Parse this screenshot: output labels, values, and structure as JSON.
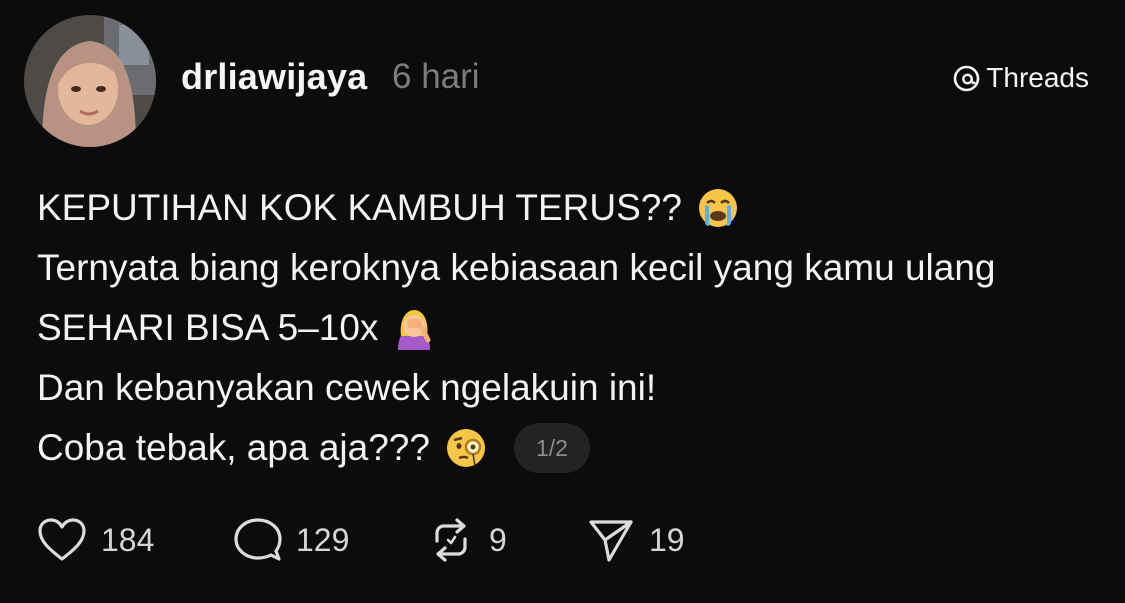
{
  "post": {
    "username": "drliawijaya",
    "timestamp": "6 hari",
    "brand": "Threads",
    "avatar_icon": "profile-photo",
    "lines": [
      "KEPUTIHAN KOK KAMBUH TERUS??",
      "Ternyata biang keroknya kebiasaan kecil yang kamu ulang",
      "SEHARI BISA 5–10x",
      "Dan kebanyakan cewek ngelakuin ini!",
      "Coba tebak, apa aja???"
    ],
    "emojis": {
      "line1": "crying-face-icon",
      "line3": "face-palm-icon",
      "line5": "monocle-face-icon"
    },
    "page_indicator": "1/2"
  },
  "actions": {
    "likes": "184",
    "replies": "129",
    "reposts": "9",
    "shares": "19",
    "icons": [
      "heart-icon",
      "comment-icon",
      "repost-icon",
      "send-icon"
    ]
  },
  "colors": {
    "background": "#0c0c0c",
    "text": "#f3f3f3",
    "muted": "#7d7d7d",
    "pill": "#232323"
  }
}
